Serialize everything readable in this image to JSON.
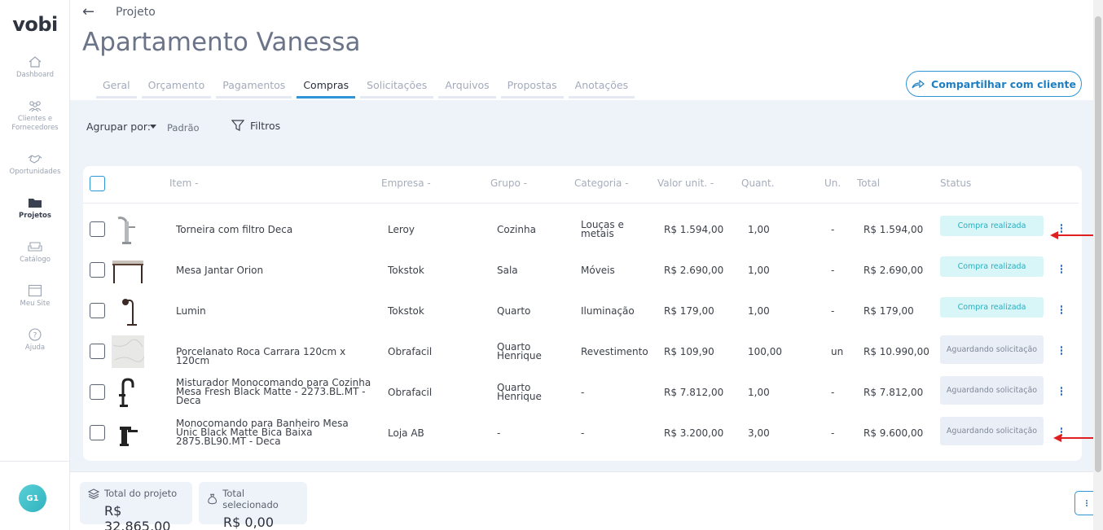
{
  "app": {
    "logo": "vobi"
  },
  "sidebar": {
    "items": [
      {
        "label": "Dashboard",
        "icon": "home-icon"
      },
      {
        "label": "Clientes e Fornecedores",
        "icon": "users-icon"
      },
      {
        "label": "Oportunidades",
        "icon": "handshake-icon"
      },
      {
        "label": "Projetos",
        "icon": "folder-icon"
      },
      {
        "label": "Catálogo",
        "icon": "sofa-icon"
      },
      {
        "label": "Meu Site",
        "icon": "browser-icon"
      },
      {
        "label": "Ajuda",
        "icon": "help-icon"
      }
    ],
    "user_initials": "G1"
  },
  "header": {
    "breadcrumb": "Projeto",
    "title": "Apartamento Vanessa",
    "share_label": "Compartilhar com cliente"
  },
  "tabs": [
    "Geral",
    "Orçamento",
    "Pagamentos",
    "Compras",
    "Solicitações",
    "Arquivos",
    "Propostas",
    "Anotações"
  ],
  "active_tab": "Compras",
  "toolbar": {
    "group_label": "Agrupar por:",
    "group_value": "Padrão",
    "filter_label": "Filtros"
  },
  "table": {
    "headers": {
      "item": "Item -",
      "empresa": "Empresa -",
      "grupo": "Grupo -",
      "categoria": "Categoria -",
      "valor": "Valor unit. -",
      "quant": "Quant.",
      "un": "Un.",
      "total": "Total",
      "status": "Status"
    },
    "rows": [
      {
        "item": "Torneira com filtro Deca",
        "empresa": "Leroy",
        "grupo": "Cozinha",
        "categoria": "Louças e metais",
        "valor": "R$ 1.594,00",
        "quant": "1,00",
        "un": "-",
        "total": "R$ 1.594,00",
        "status": "Compra realizada",
        "status_type": "done",
        "thumb": "faucet"
      },
      {
        "item": "Mesa Jantar Orion",
        "empresa": "Tokstok",
        "grupo": "Sala",
        "categoria": "Móveis",
        "valor": "R$ 2.690,00",
        "quant": "1,00",
        "un": "-",
        "total": "R$ 2.690,00",
        "status": "Compra realizada",
        "status_type": "done",
        "thumb": "table"
      },
      {
        "item": "Lumin",
        "empresa": "Tokstok",
        "grupo": "Quarto",
        "categoria": "Iluminação",
        "valor": "R$ 179,00",
        "quant": "1,00",
        "un": "-",
        "total": "R$ 179,00",
        "status": "Compra realizada",
        "status_type": "done",
        "thumb": "lamp"
      },
      {
        "item": "Porcelanato Roca Carrara 120cm x 120cm",
        "empresa": "Obrafacil",
        "grupo": "Quarto Henrique",
        "categoria": "Revestimento",
        "valor": "R$ 109,90",
        "quant": "100,00",
        "un": "un",
        "total": "R$ 10.990,00",
        "status": "Aguardando solicitação",
        "status_type": "wait",
        "thumb": "marble"
      },
      {
        "item": "Misturador Monocomando para Cozinha Mesa Fresh Black Matte - 2273.BL.MT - Deca",
        "empresa": "Obrafacil",
        "grupo": "Quarto Henrique",
        "categoria": "-",
        "valor": "R$ 7.812,00",
        "quant": "1,00",
        "un": "-",
        "total": "R$ 7.812,00",
        "status": "Aguardando solicitação",
        "status_type": "wait",
        "thumb": "mixer"
      },
      {
        "item": "Monocomando para Banheiro Mesa Unic Black Matte Bica Baixa 2875.BL90.MT - Deca",
        "empresa": "Loja AB",
        "grupo": "-",
        "categoria": "-",
        "valor": "R$ 3.200,00",
        "quant": "3,00",
        "un": "-",
        "total": "R$ 9.600,00",
        "status": "Aguardando solicitação",
        "status_type": "wait",
        "thumb": "basin-mixer"
      }
    ]
  },
  "footer": {
    "total_project_label": "Total do projeto",
    "total_project_value": "R$ 32.865,00",
    "total_selected_label": "Total selecionado",
    "total_selected_value": "R$ 0,00"
  },
  "colors": {
    "accent": "#2e95d6",
    "done_bg": "#d8f5f7",
    "done_text": "#2aaebf",
    "wait_bg": "#eaeef6",
    "annotation": "#e02020"
  }
}
